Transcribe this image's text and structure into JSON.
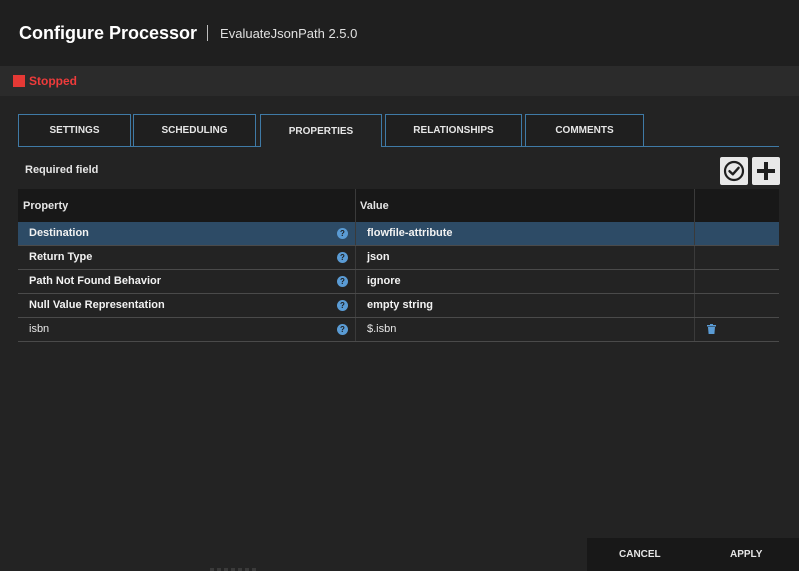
{
  "header": {
    "title": "Configure Processor",
    "subtitle": "EvaluateJsonPath 2.5.0"
  },
  "status": {
    "text": "Stopped",
    "color": "#e53935"
  },
  "tabs": [
    {
      "label": "SETTINGS"
    },
    {
      "label": "SCHEDULING"
    },
    {
      "label": "PROPERTIES",
      "active": true
    },
    {
      "label": "RELATIONSHIPS"
    },
    {
      "label": "COMMENTS"
    }
  ],
  "required_label": "Required field",
  "toolbar": {
    "verify_icon": "check-circle-icon",
    "add_icon": "plus-icon"
  },
  "table": {
    "headers": [
      "Property",
      "Value",
      ""
    ],
    "rows": [
      {
        "property": "Destination",
        "value": "flowfile-attribute",
        "required": true,
        "selected": true
      },
      {
        "property": "Return Type",
        "value": "json",
        "required": true
      },
      {
        "property": "Path Not Found Behavior",
        "value": "ignore",
        "required": true
      },
      {
        "property": "Null Value Representation",
        "value": "empty string",
        "required": true
      },
      {
        "property": "isbn",
        "value": "$.isbn",
        "required": false,
        "deletable": true
      }
    ]
  },
  "footer": {
    "cancel_label": "CANCEL",
    "apply_label": "APPLY"
  },
  "colors": {
    "accent": "#3f7aa6",
    "selected_row": "#2d4b66",
    "help_icon": "#5a9bd4"
  }
}
